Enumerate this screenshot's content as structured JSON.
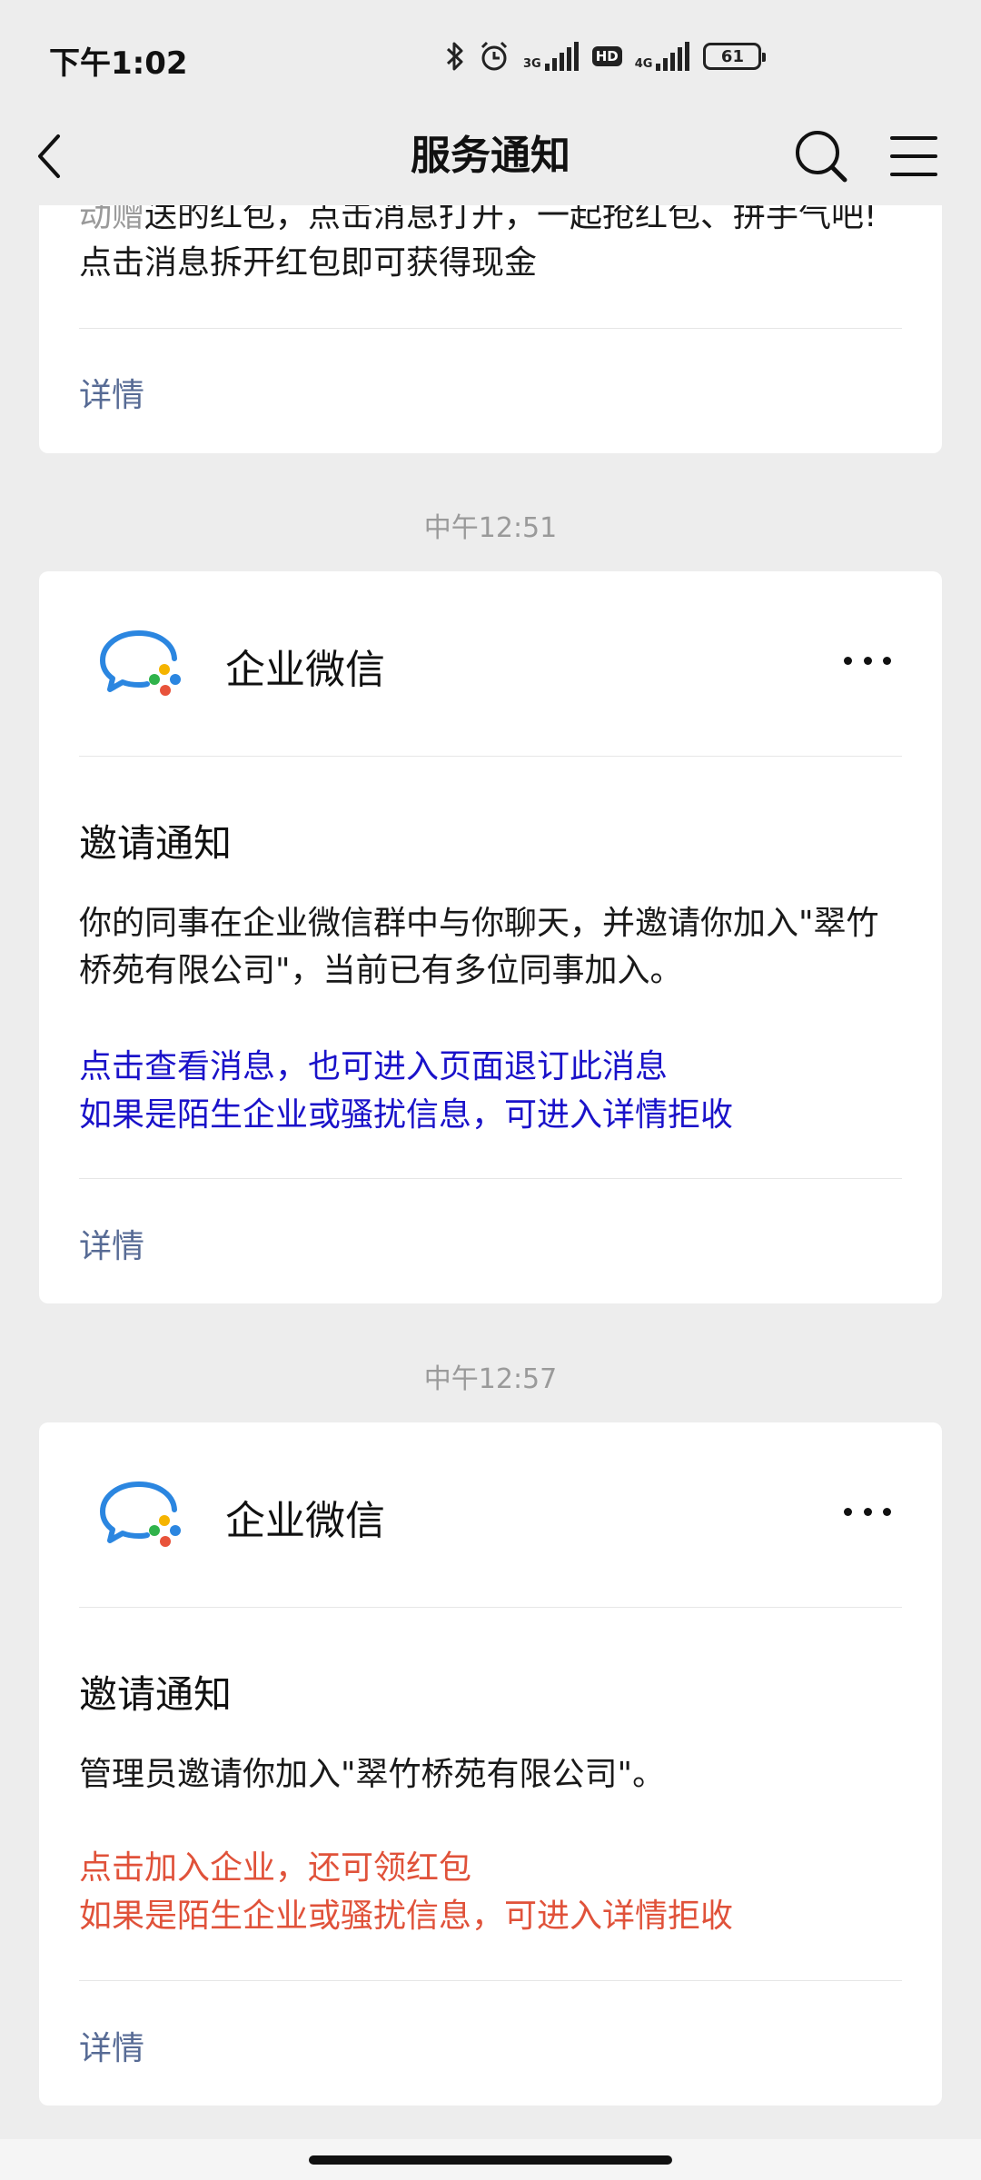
{
  "status_bar": {
    "time": "下午1:02",
    "net1": "3G",
    "hd": "HD",
    "net2": "4G",
    "battery": "61"
  },
  "nav": {
    "title": "服务通知"
  },
  "colors": {
    "link": "#576b95",
    "hint_blue": "#1a12c9",
    "hint_red": "#e0523a",
    "muted": "#9a9a9a"
  },
  "top_card": {
    "line1_prefix": "动赠",
    "line1_rest": "送的红包，点击消息打开，一起抢红包、拼手气吧!",
    "line2": "点击消息拆开红包即可获得现金",
    "details": "详情"
  },
  "messages": [
    {
      "timestamp": "中午12:51",
      "app_name": "企业微信",
      "title": "邀请通知",
      "body": "你的同事在企业微信群中与你聊天，并邀请你加入\"翠竹桥苑有限公司\"，当前已有多位同事加入。",
      "hint_line1": "点击查看消息，也可进入页面退订此消息",
      "hint_line2": "如果是陌生企业或骚扰信息，可进入详情拒收",
      "details": "详情"
    },
    {
      "timestamp": "中午12:57",
      "app_name": "企业微信",
      "title": "邀请通知",
      "body": "管理员邀请你加入\"翠竹桥苑有限公司\"。",
      "hint_line1": "点击加入企业，还可领红包",
      "hint_line2": "如果是陌生企业或骚扰信息，可进入详情拒收",
      "details": "详情"
    }
  ]
}
